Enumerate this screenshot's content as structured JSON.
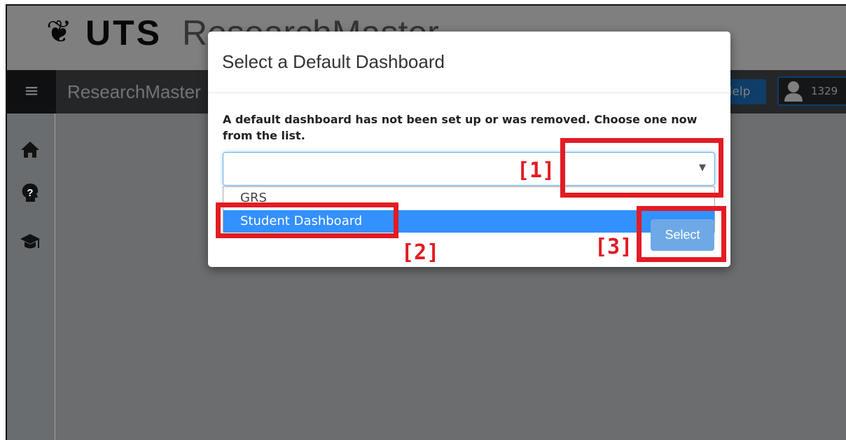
{
  "logo": {
    "mark": "❦",
    "uts": "UTS",
    "product": "ResearchMaster"
  },
  "topnav": {
    "menu_icon": "hamburger-icon",
    "title": "ResearchMaster",
    "help_label": "Help",
    "user_id": "1329"
  },
  "sidebar": {
    "items": [
      "home-icon",
      "help-circle-icon",
      "graduation-cap-icon"
    ]
  },
  "modal": {
    "title": "Select a Default Dashboard",
    "message": "A default dashboard has not been set up or was removed. Choose one now from the list.",
    "select_value": "",
    "options": [
      "GRS",
      "Student Dashboard"
    ],
    "highlighted_option": "Student Dashboard",
    "select_button": "Select"
  },
  "annotations": [
    "[1]",
    "[2]",
    "[3]"
  ],
  "colors": {
    "annotation": "#e31b23",
    "accent": "#3390ff",
    "button": "#6fa8e6",
    "nav": "#4a4d51"
  }
}
